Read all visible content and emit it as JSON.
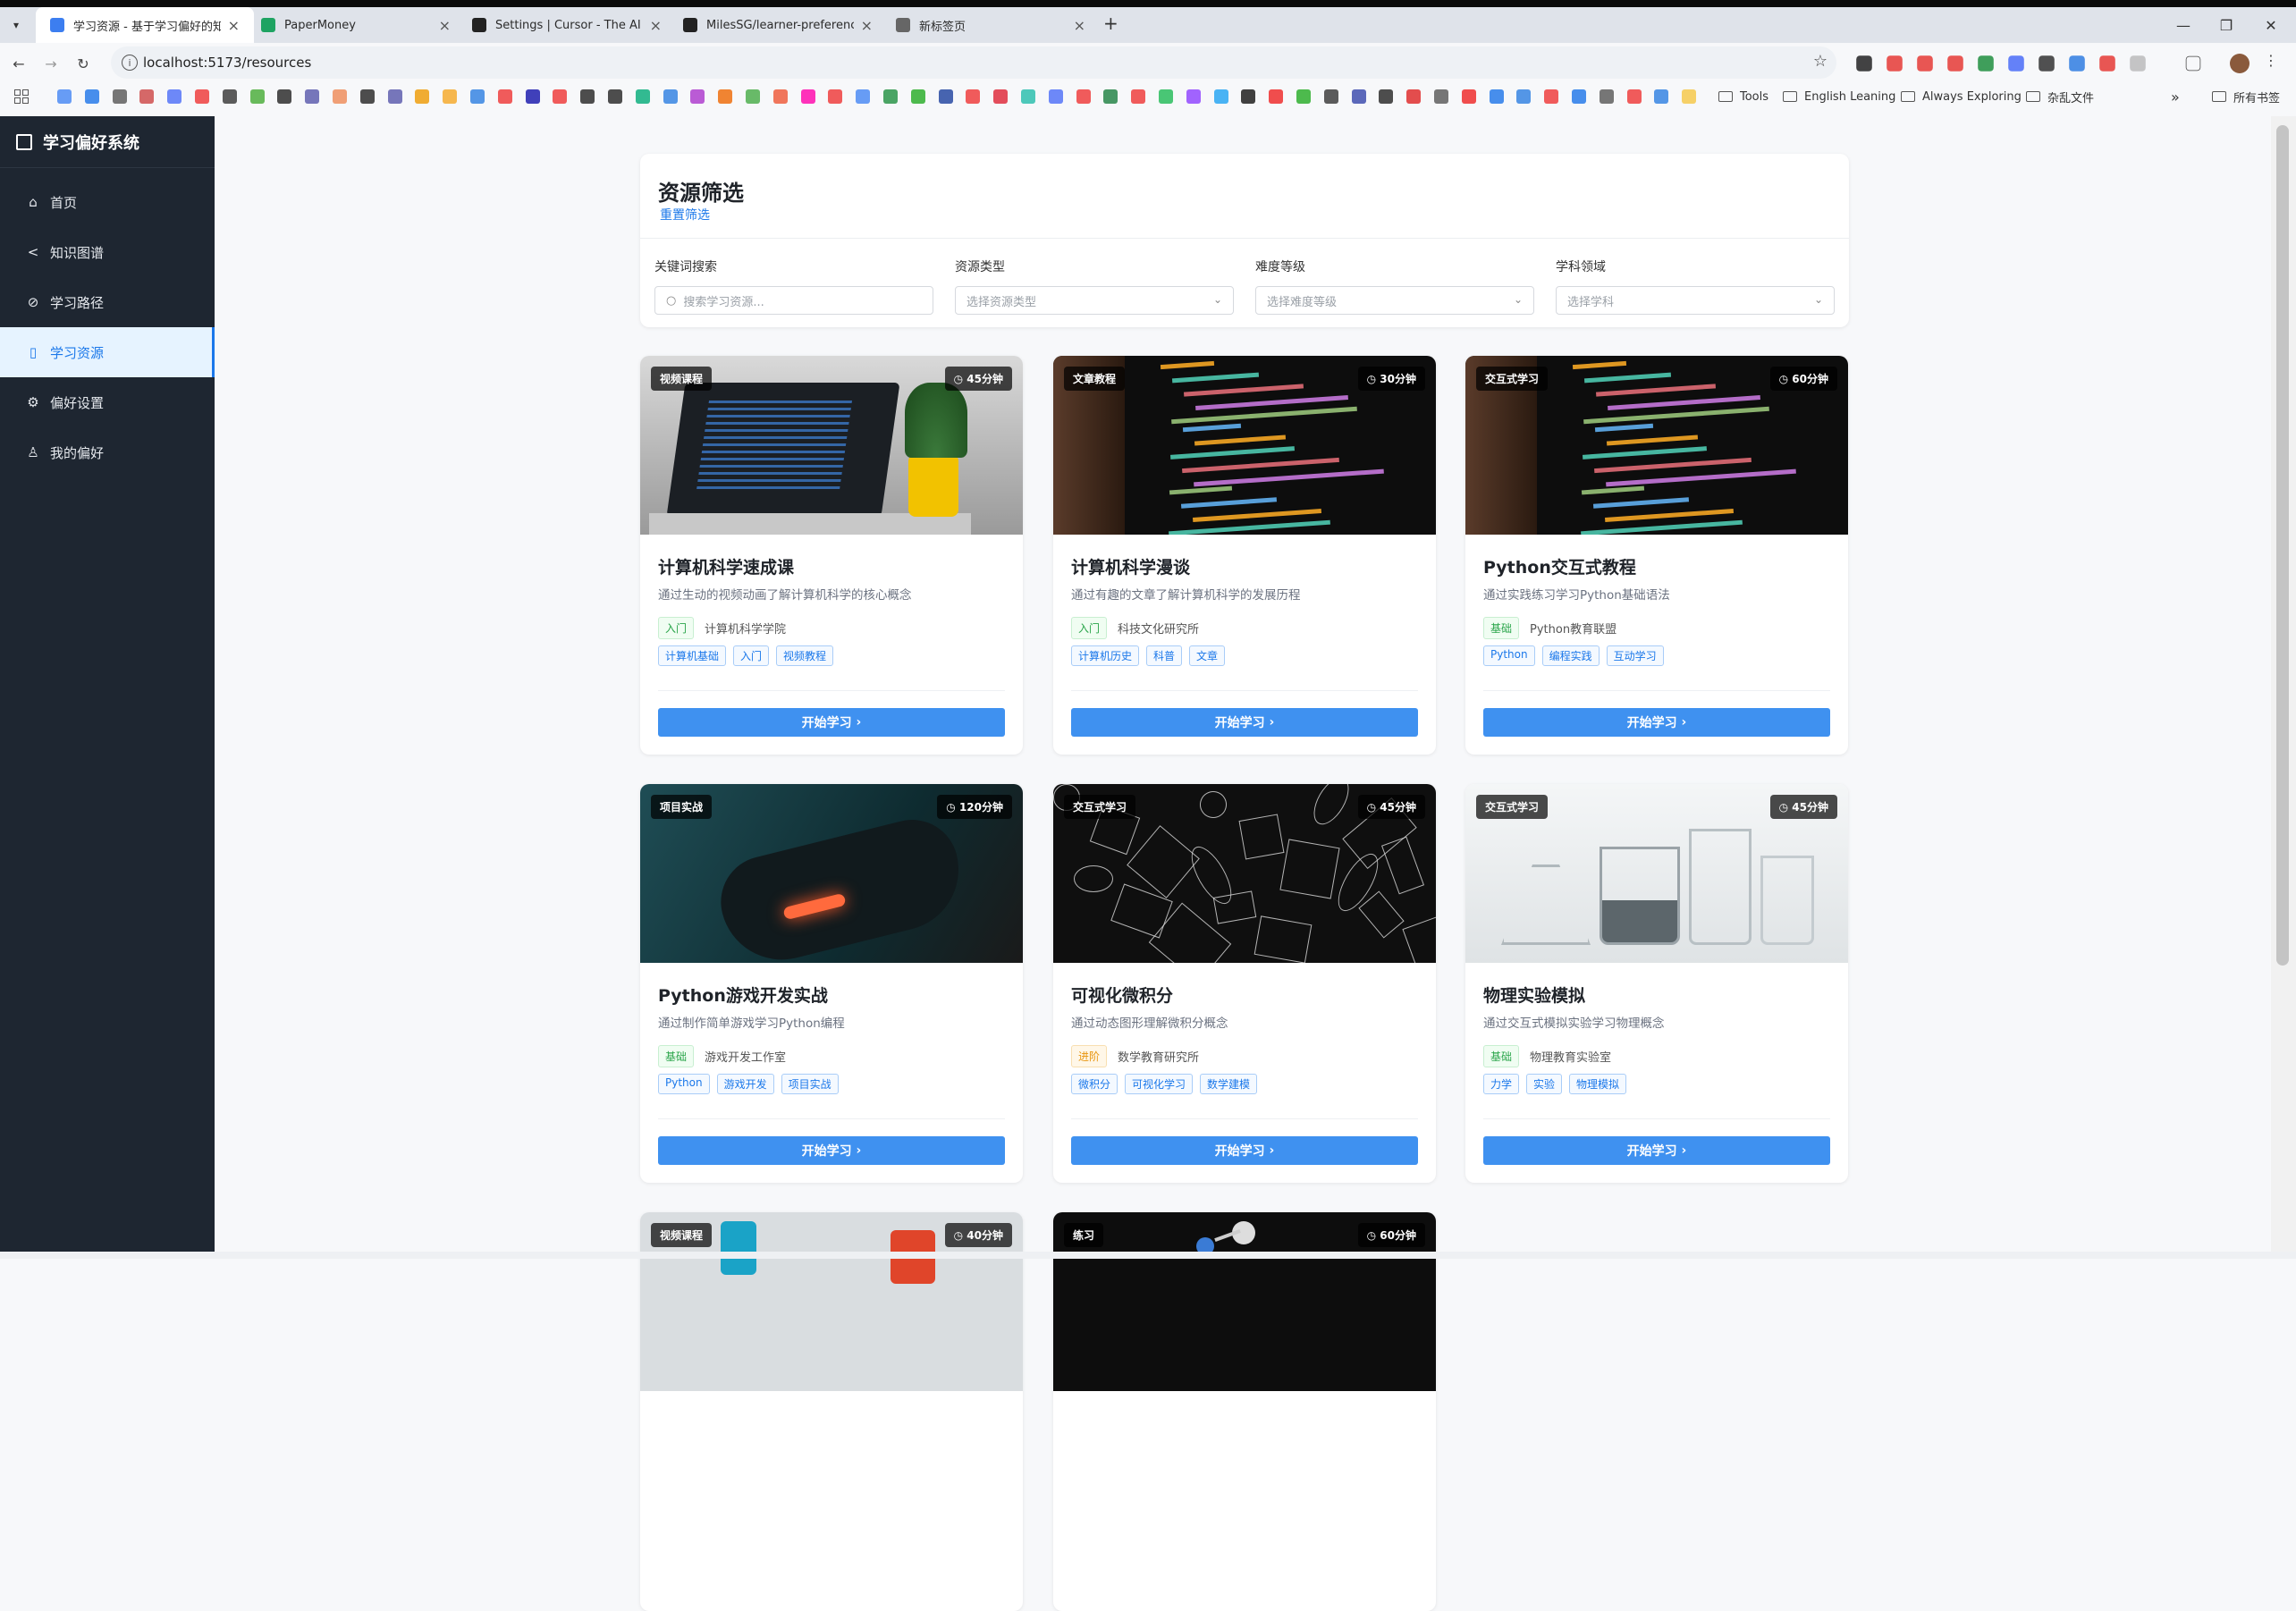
{
  "browser": {
    "tabs": [
      {
        "title": "学习资源 - 基于学习偏好的知识...",
        "color": "#3c7ef0",
        "active": true
      },
      {
        "title": "PaperMoney",
        "color": "#1ea362",
        "active": false
      },
      {
        "title": "Settings | Cursor - The AI Co...",
        "color": "#222222",
        "active": false
      },
      {
        "title": "MilesSG/learner-preference-...",
        "color": "#222222",
        "active": false
      },
      {
        "title": "新标签页",
        "color": "#666666",
        "active": false
      }
    ],
    "url": "localhost:5173/resources",
    "bookmark_folders": [
      "Tools",
      "English Leaning",
      "Always Exploring",
      "杂乱文件"
    ],
    "all_bookmarks": "所有书签"
  },
  "sidebar": {
    "brand": "学习偏好系统",
    "items": [
      {
        "label": "首页",
        "icon": "home-icon",
        "glyph": "⌂"
      },
      {
        "label": "知识图谱",
        "icon": "share-icon",
        "glyph": "<"
      },
      {
        "label": "学习路径",
        "icon": "path-icon",
        "glyph": "⊘"
      },
      {
        "label": "学习资源",
        "icon": "book-icon",
        "glyph": "▯"
      },
      {
        "label": "偏好设置",
        "icon": "gear-icon",
        "glyph": "⚙"
      },
      {
        "label": "我的偏好",
        "icon": "user-icon",
        "glyph": "♙"
      }
    ],
    "active_index": 3
  },
  "filter": {
    "title": "资源筛选",
    "reset": "重置筛选",
    "keyword": {
      "label": "关键词搜索",
      "placeholder": "搜索学习资源..."
    },
    "type": {
      "label": "资源类型",
      "placeholder": "选择资源类型"
    },
    "difficulty": {
      "label": "难度等级",
      "placeholder": "选择难度等级"
    },
    "subject": {
      "label": "学科领域",
      "placeholder": "选择学科"
    }
  },
  "cards": [
    {
      "type": "视频课程",
      "duration": "45分钟",
      "title": "计算机科学速成课",
      "desc": "通过生动的视频动画了解计算机科学的核心概念",
      "level": "入门",
      "level_color": "green",
      "provider": "计算机科学学院",
      "tags": [
        "计算机基础",
        "入门",
        "视频教程"
      ],
      "button": "开始学习",
      "image": "laptop"
    },
    {
      "type": "文章教程",
      "duration": "30分钟",
      "title": "计算机科学漫谈",
      "desc": "通过有趣的文章了解计算机科学的发展历程",
      "level": "入门",
      "level_color": "green",
      "provider": "科技文化研究所",
      "tags": [
        "计算机历史",
        "科普",
        "文章"
      ],
      "button": "开始学习",
      "image": "code"
    },
    {
      "type": "交互式学习",
      "duration": "60分钟",
      "title": "Python交互式教程",
      "desc": "通过实践练习学习Python基础语法",
      "level": "基础",
      "level_color": "green",
      "provider": "Python教育联盟",
      "tags": [
        "Python",
        "编程实践",
        "互动学习"
      ],
      "button": "开始学习",
      "image": "code"
    },
    {
      "type": "项目实战",
      "duration": "120分钟",
      "title": "Python游戏开发实战",
      "desc": "通过制作简单游戏学习Python编程",
      "level": "基础",
      "level_color": "green",
      "provider": "游戏开发工作室",
      "tags": [
        "Python",
        "游戏开发",
        "项目实战"
      ],
      "button": "开始学习",
      "image": "gamepad"
    },
    {
      "type": "交互式学习",
      "duration": "45分钟",
      "title": "可视化微积分",
      "desc": "通过动态图形理解微积分概念",
      "level": "进阶",
      "level_color": "orange",
      "provider": "数学教育研究所",
      "tags": [
        "微积分",
        "可视化学习",
        "数学建模"
      ],
      "button": "开始学习",
      "image": "math"
    },
    {
      "type": "交互式学习",
      "duration": "45分钟",
      "title": "物理实验模拟",
      "desc": "通过交互式模拟实验学习物理概念",
      "level": "基础",
      "level_color": "green",
      "provider": "物理教育实验室",
      "tags": [
        "力学",
        "实验",
        "物理模拟"
      ],
      "button": "开始学习",
      "image": "glass"
    },
    {
      "type": "视频课程",
      "duration": "40分钟",
      "title": "",
      "desc": "",
      "level": "",
      "provider": "",
      "tags": [],
      "button": "",
      "image": "chem"
    },
    {
      "type": "练习",
      "duration": "60分钟",
      "title": "",
      "desc": "",
      "level": "",
      "provider": "",
      "tags": [],
      "button": "",
      "image": "mol"
    }
  ]
}
